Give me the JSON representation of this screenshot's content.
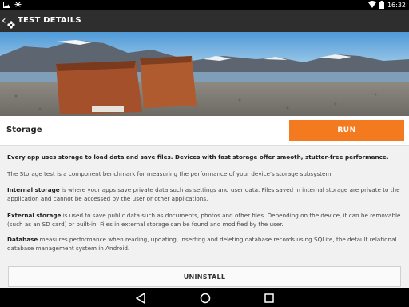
{
  "status_bar": {
    "time": "16:32",
    "icons": [
      "image-icon",
      "snowflake-icon",
      "wifi-icon",
      "battery-icon"
    ]
  },
  "app_bar": {
    "title": "TEST DETAILS"
  },
  "test": {
    "name": "Storage",
    "run_label": "RUN",
    "uninstall_label": "UNINSTALL"
  },
  "description": {
    "lead": "Every app uses storage to load data and save files. Devices with fast storage offer smooth, stutter-free performance.",
    "intro": "The Storage test is a component benchmark for measuring the performance of your device's storage subsystem.",
    "internal_term": "Internal storage",
    "internal_text": " is where your apps save private data such as settings and user data. Files saved in internal storage are private to the application and cannot be accessed by the user or other applications.",
    "external_term": "External storage",
    "external_text": " is used to save public data such as documents, photos and other files. Depending on the device, it can be removable (such as an SD card) or built-in. Files in external storage can be found and modified by the user.",
    "database_term": "Database",
    "database_text": " measures performance when reading, updating, inserting and deleting database records using SQLite, the default relational database management system in Android."
  },
  "colors": {
    "accent": "#f47a20",
    "app_bar": "#2e2e2e",
    "content_bg": "#f1f1f1"
  }
}
